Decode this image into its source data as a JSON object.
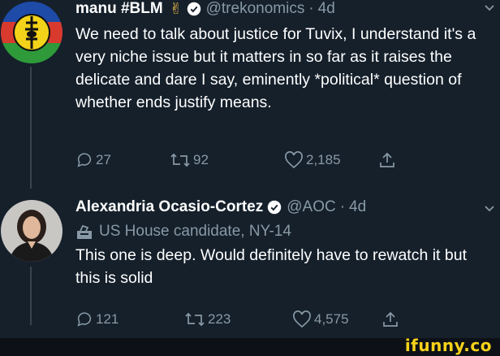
{
  "tweets": [
    {
      "name": "manu #BLM",
      "name_emoji": "✌",
      "handle": "@trekonomics",
      "separator": "·",
      "age": "4d",
      "text": "We need to talk about justice for Tuvix, I understand it's a very niche issue but it matters in so far as it raises the delicate and dare I say, eminently *political* question of whether ends justify means.",
      "replies": "27",
      "retweets": "92",
      "likes": "2,185"
    },
    {
      "name": "Alexandria Ocasio-Cortez",
      "handle": "@AOC",
      "separator": "·",
      "age": "4d",
      "label": "US House candidate, NY-14",
      "text": "This one is deep. Would definitely have to rewatch it but this is solid",
      "replies": "121",
      "retweets": "223",
      "likes": "4,575"
    }
  ],
  "watermark": "ifunny.co",
  "colors": {
    "background": "#15202b",
    "secondary_text": "#8899a6",
    "verified": "#ffffff",
    "watermark": "#f6d21a"
  }
}
